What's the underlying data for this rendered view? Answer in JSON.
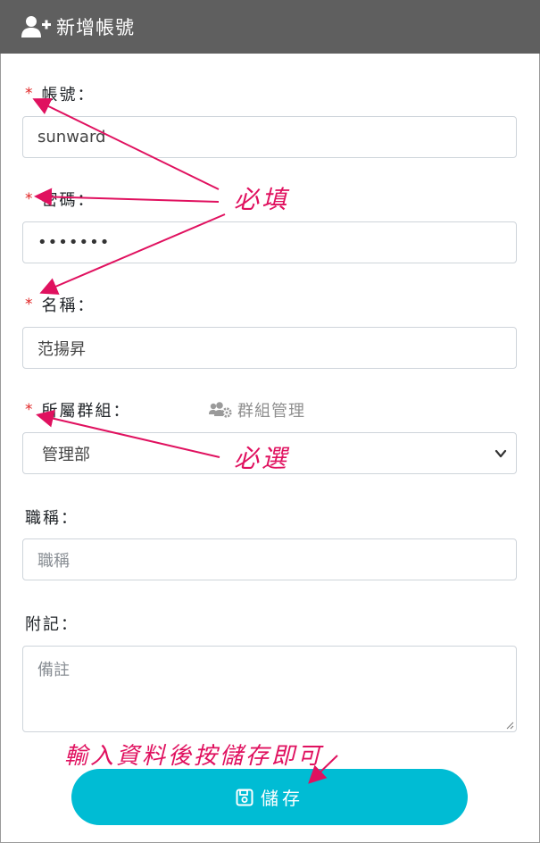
{
  "header": {
    "title": "新增帳號",
    "icon": "user-plus-icon"
  },
  "form": {
    "account": {
      "label": "帳號：",
      "required_mark": "*",
      "value": "sunward"
    },
    "password": {
      "label": "密碼：",
      "required_mark": "*",
      "value": "•••••••"
    },
    "name": {
      "label": "名稱：",
      "required_mark": "*",
      "value": "范揚昇"
    },
    "group": {
      "label": "所屬群組：",
      "required_mark": "*",
      "selected": "管理部",
      "manage_link": "群組管理",
      "manage_icon": "users-gear-icon"
    },
    "title": {
      "label": "職稱：",
      "placeholder": "職稱"
    },
    "remark": {
      "label": "附記：",
      "placeholder": "備註"
    }
  },
  "save_button": {
    "label": "儲存",
    "icon": "save-icon"
  },
  "annotations": {
    "required": "必填",
    "required_select": "必選",
    "instruction": "輸入資料後按儲存即可"
  },
  "colors": {
    "header_bg": "#5f5f5f",
    "button_bg": "#00bcd4",
    "required": "#e02424",
    "annotation": "#e0115f"
  }
}
